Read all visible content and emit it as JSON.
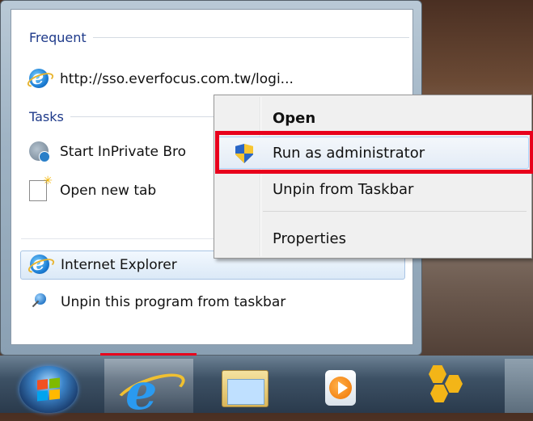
{
  "jump_list": {
    "frequent_header": "Frequent",
    "frequent_items": [
      {
        "label": "http://sso.everfocus.com.tw/logi...",
        "icon": "ie-icon"
      }
    ],
    "tasks_header": "Tasks",
    "task_items": [
      {
        "label": "Start InPrivate Bro",
        "icon": "inprivate-icon"
      },
      {
        "label": "Open new tab",
        "icon": "new-tab-icon"
      }
    ],
    "program_item": {
      "label": "Internet Explorer",
      "icon": "ie-icon"
    },
    "unpin_item": {
      "label": "Unpin this program from taskbar",
      "icon": "pin-icon"
    }
  },
  "context_menu": {
    "items": [
      {
        "label": "Open",
        "bold": true
      },
      {
        "label": "Run as administrator",
        "icon": "uac-shield-icon"
      },
      {
        "label": "Unpin from Taskbar"
      },
      {
        "label": "Properties"
      }
    ]
  },
  "taskbar": {
    "buttons": [
      "start-orb",
      "internet-explorer",
      "windows-explorer",
      "media-player",
      "games"
    ]
  },
  "colors": {
    "highlight_box": "#e8001c",
    "header_text": "#1e3a8a"
  }
}
